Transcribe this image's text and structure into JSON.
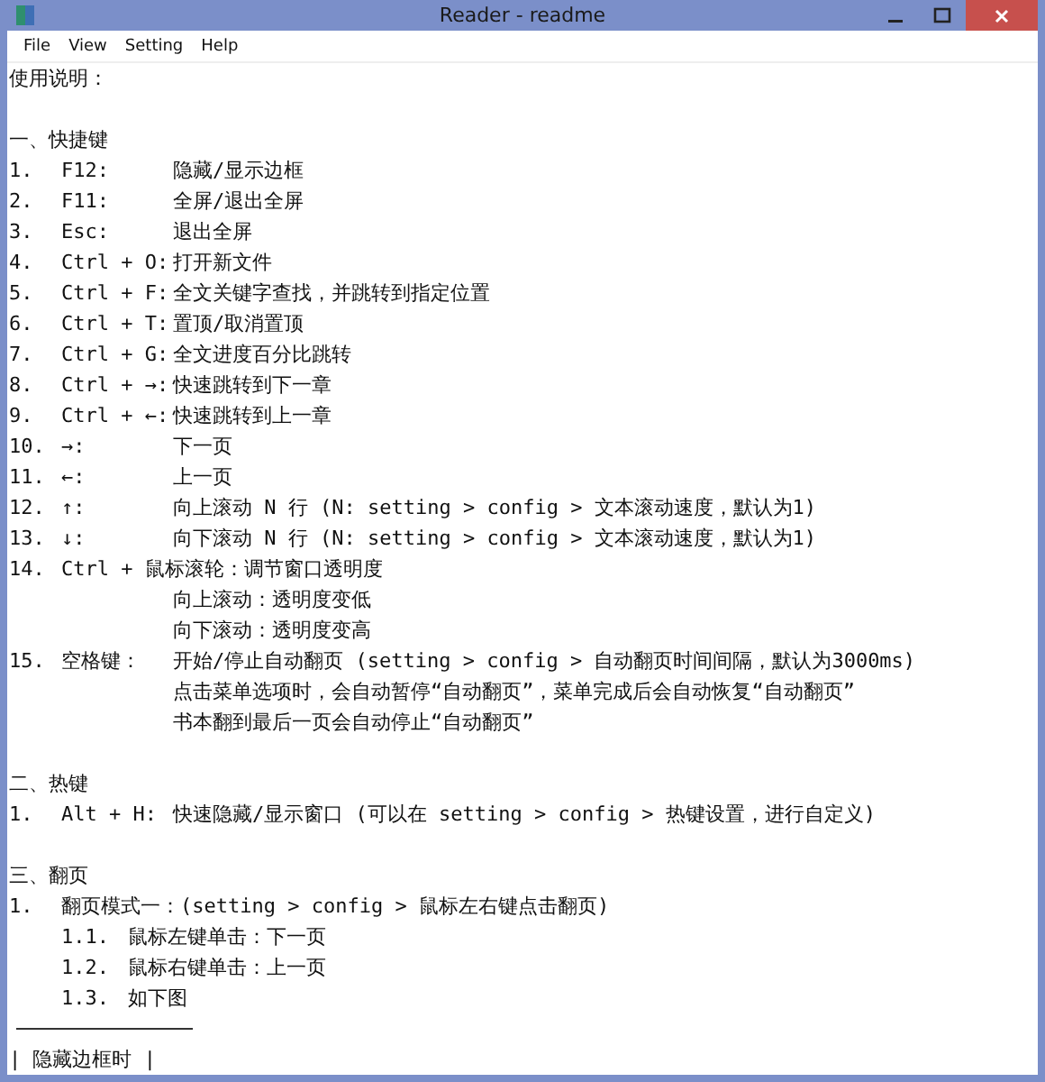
{
  "window": {
    "title": "Reader - readme"
  },
  "menu": [
    "File",
    "View",
    "Setting",
    "Help"
  ],
  "lines": [
    {
      "kind": "plain",
      "text": "使用说明："
    },
    {
      "kind": "blank"
    },
    {
      "kind": "plain",
      "text": "一、快捷键"
    },
    {
      "kind": "entry",
      "num": "1.",
      "key": "F12:",
      "text": "隐藏/显示边框"
    },
    {
      "kind": "entry",
      "num": "2.",
      "key": "F11:",
      "text": "全屏/退出全屏"
    },
    {
      "kind": "entry",
      "num": "3.",
      "key": "Esc:",
      "text": "退出全屏"
    },
    {
      "kind": "entry",
      "num": "4.",
      "key": "Ctrl + O:",
      "text": "打开新文件"
    },
    {
      "kind": "entry",
      "num": "5.",
      "key": "Ctrl + F:",
      "text": "全文关键字查找，并跳转到指定位置"
    },
    {
      "kind": "entry",
      "num": "6.",
      "key": "Ctrl + T:",
      "text": "置顶/取消置顶"
    },
    {
      "kind": "entry",
      "num": "7.",
      "key": "Ctrl + G:",
      "text": "全文进度百分比跳转"
    },
    {
      "kind": "entry",
      "num": "8.",
      "key": "Ctrl + →:",
      "text": "快速跳转到下一章"
    },
    {
      "kind": "entry",
      "num": "9.",
      "key": "Ctrl + ←:",
      "text": "快速跳转到上一章"
    },
    {
      "kind": "entry",
      "num": "10.",
      "key": "→:",
      "text": "下一页"
    },
    {
      "kind": "entry",
      "num": "11.",
      "key": "←:",
      "text": "上一页"
    },
    {
      "kind": "entry",
      "num": "12.",
      "key": "↑:",
      "text": "向上滚动 N 行 (N: setting > config > 文本滚动速度，默认为1)"
    },
    {
      "kind": "entry",
      "num": "13.",
      "key": "↓:",
      "text": "向下滚动 N 行 (N: setting > config > 文本滚动速度，默认为1)"
    },
    {
      "kind": "long",
      "num": "14.",
      "text": "Ctrl + 鼠标滚轮：调节窗口透明度"
    },
    {
      "kind": "cont",
      "text": "向上滚动：透明度变低"
    },
    {
      "kind": "cont",
      "text": "向下滚动：透明度变高"
    },
    {
      "kind": "entry",
      "num": "15.",
      "key": "空格键：",
      "text": "开始/停止自动翻页 (setting > config > 自动翻页时间间隔，默认为3000ms)"
    },
    {
      "kind": "cont",
      "text": "点击菜单选项时，会自动暂停“自动翻页”，菜单完成后会自动恢复“自动翻页”"
    },
    {
      "kind": "cont",
      "text": "书本翻到最后一页会自动停止“自动翻页”"
    },
    {
      "kind": "blank"
    },
    {
      "kind": "plain",
      "text": "二、热键"
    },
    {
      "kind": "entry",
      "num": "1.",
      "key": "Alt + H:",
      "text": "快速隐藏/显示窗口 (可以在 setting > config > 热键设置，进行自定义)"
    },
    {
      "kind": "blank"
    },
    {
      "kind": "plain",
      "text": "三、翻页"
    },
    {
      "kind": "long",
      "num": "1.",
      "text": "翻页模式一：(setting > config > 鼠标左右键点击翻页)"
    },
    {
      "kind": "sub",
      "num": "1.1.",
      "text": "鼠标左键单击：下一页"
    },
    {
      "kind": "sub",
      "num": "1.2.",
      "text": "鼠标右键单击：上一页"
    },
    {
      "kind": "sub",
      "num": "1.3.",
      "text": "如下图"
    },
    {
      "kind": "rule"
    },
    {
      "kind": "plain",
      "text": "| 隐藏边框时    |"
    }
  ]
}
